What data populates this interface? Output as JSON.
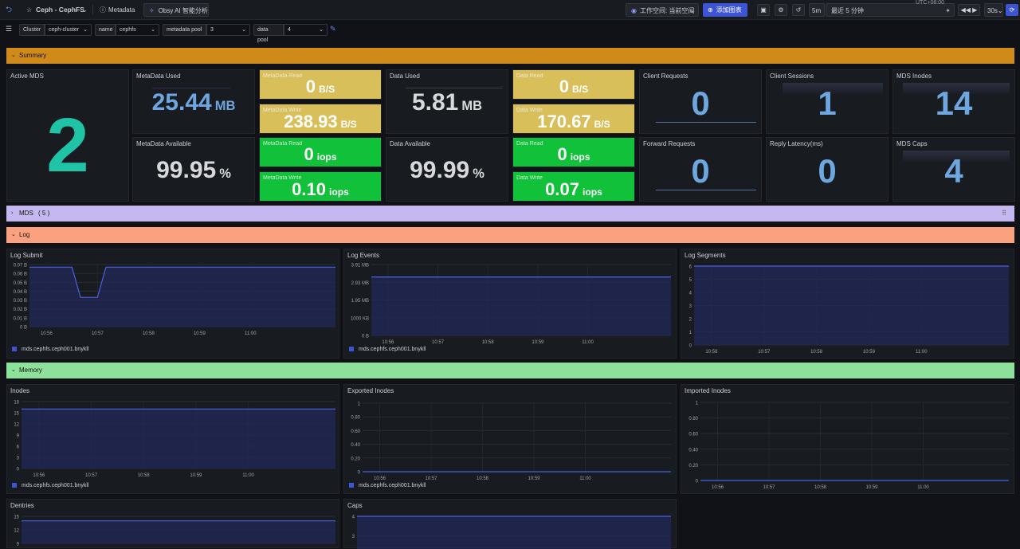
{
  "topbar": {
    "title": "Ceph - CephFS",
    "metadata_label": "Metadata",
    "ai_label": "Obsy AI 智能分析",
    "workspace_label": "工作空间: 当前空间",
    "add_chart_label": "添加图表",
    "time_short": "5m",
    "time_range": "最近 5 分钟",
    "refresh_interval": "30s",
    "timezone": "UTC+08:00"
  },
  "filters": [
    {
      "label": "Cluster",
      "value": "ceph-cluster"
    },
    {
      "label": "name",
      "value": "cephfs"
    },
    {
      "label": "metadata pool",
      "value": "3"
    },
    {
      "label": "data pool",
      "value": "4"
    }
  ],
  "rows": {
    "summary": "Summary",
    "mds": "MDS",
    "mds_count": "( 5 )",
    "log": "Log",
    "memory": "Memory"
  },
  "colors": {
    "summary": "#d08a1a",
    "mds": "#c5b8f0",
    "log": "#fba17f",
    "memory": "#8ee19b",
    "yellow_tile": "#d9bf59",
    "green_tile": "#11c13a",
    "series": "#3d55d4"
  },
  "summary": {
    "active_mds": {
      "title": "Active MDS",
      "value": "2"
    },
    "metadata_used": {
      "title": "MetaData Used",
      "value": "25.44",
      "unit": "MB"
    },
    "metadata_available": {
      "title": "MetaData Available",
      "value": "99.95",
      "unit": "%"
    },
    "data_used": {
      "title": "Data Used",
      "value": "5.81",
      "unit": "MB"
    },
    "data_available": {
      "title": "Data Available",
      "value": "99.99",
      "unit": "%"
    },
    "md_read_bs": {
      "title": "MetaData Read",
      "value": "0",
      "unit": "B/S"
    },
    "md_write_bs": {
      "title": "MetaData Write",
      "value": "238.93",
      "unit": "B/S"
    },
    "md_read_iops": {
      "title": "MetaData Read",
      "value": "0",
      "unit": "iops"
    },
    "md_write_iops": {
      "title": "MetaData Write",
      "value": "0.10",
      "unit": "iops"
    },
    "data_read_bs": {
      "title": "Data Read",
      "value": "0",
      "unit": "B/S"
    },
    "data_write_bs": {
      "title": "Data Write",
      "value": "170.67",
      "unit": "B/S"
    },
    "data_read_iops": {
      "title": "Data Read",
      "value": "0",
      "unit": "iops"
    },
    "data_write_iops": {
      "title": "Data Write",
      "value": "0.07",
      "unit": "iops"
    },
    "client_requests": {
      "title": "Client Requests",
      "value": "0"
    },
    "client_sessions": {
      "title": "Client Sessions",
      "value": "1"
    },
    "mds_inodes": {
      "title": "MDS Inodes",
      "value": "14"
    },
    "forward_requests": {
      "title": "Forward Requests",
      "value": "0"
    },
    "reply_latency": {
      "title": "Reply Latency(ms)",
      "value": "0"
    },
    "mds_caps": {
      "title": "MDS Caps",
      "value": "4"
    }
  },
  "chart_data": [
    {
      "id": "log-submit",
      "type": "line",
      "title": "Log Submit",
      "x": [
        "10:56",
        "10:57",
        "10:58",
        "10:59",
        "11:00"
      ],
      "y_ticks": [
        "0 B",
        "0.01 B",
        "0.02 B",
        "0.03 B",
        "0.04 B",
        "0.05 B",
        "0.06 B",
        "0.07 B"
      ],
      "ylim": [
        0,
        0.07
      ],
      "series": [
        {
          "name": "mds.cephfs.ceph001.bnykll",
          "points": [
            [
              "10:55:40",
              0.067
            ],
            [
              "10:56:30",
              0.067
            ],
            [
              "10:56:40",
              0.033
            ],
            [
              "10:57:00",
              0.033
            ],
            [
              "10:57:10",
              0.067
            ],
            [
              "11:01:40",
              0.067
            ]
          ]
        }
      ],
      "legend": true
    },
    {
      "id": "log-events",
      "type": "area",
      "title": "Log Events",
      "x": [
        "10:56",
        "10:57",
        "10:58",
        "10:59",
        "11:00"
      ],
      "y_ticks": [
        "0 B",
        "1000 KB",
        "1.95 MB",
        "2.93 MB",
        "3.91 MB"
      ],
      "ylim": [
        0,
        4
      ],
      "series": [
        {
          "name": "mds.cephfs.ceph001.bnykll",
          "points": [
            [
              "10:55:40",
              3.3
            ],
            [
              "11:01:40",
              3.3
            ]
          ]
        }
      ],
      "legend": true
    },
    {
      "id": "log-segments",
      "type": "area",
      "title": "Log Segments",
      "x": [
        "10:56",
        "10:57",
        "10:58",
        "10:59",
        "11:00"
      ],
      "y_ticks": [
        "0",
        "1",
        "2",
        "3",
        "4",
        "5",
        "6"
      ],
      "ylim": [
        0,
        6
      ],
      "series": [
        {
          "points": [
            [
              "10:55:40",
              6
            ],
            [
              "11:01:40",
              6
            ]
          ]
        }
      ],
      "legend": false
    },
    {
      "id": "inodes",
      "type": "area",
      "title": "Inodes",
      "x": [
        "10:56",
        "10:57",
        "10:58",
        "10:59",
        "11:00"
      ],
      "y_ticks": [
        "0",
        "3",
        "6",
        "9",
        "12",
        "15",
        "18"
      ],
      "ylim": [
        0,
        18
      ],
      "series": [
        {
          "name": "mds.cephfs.ceph001.bnykll",
          "points": [
            [
              "10:55:40",
              16
            ],
            [
              "11:01:40",
              16
            ]
          ]
        }
      ],
      "legend": true
    },
    {
      "id": "exported-inodes",
      "type": "line",
      "title": "Exported Inodes",
      "x": [
        "10:56",
        "10:57",
        "10:58",
        "10:59",
        "11:00"
      ],
      "y_ticks": [
        "0",
        "0.20",
        "0.40",
        "0.60",
        "0.80",
        "1"
      ],
      "ylim": [
        0,
        1
      ],
      "series": [
        {
          "name": "mds.cephfs.ceph001.bnykll",
          "points": [
            [
              "10:55:40",
              0
            ],
            [
              "11:01:40",
              0
            ]
          ]
        }
      ],
      "legend": true
    },
    {
      "id": "imported-inodes",
      "type": "line",
      "title": "Imported Inodes",
      "x": [
        "10:56",
        "10:57",
        "10:58",
        "10:59",
        "11:00"
      ],
      "y_ticks": [
        "0",
        "0.20",
        "0.40",
        "0.60",
        "0.80",
        "1"
      ],
      "ylim": [
        0,
        1
      ],
      "series": [
        {
          "points": [
            [
              "10:55:40",
              0
            ],
            [
              "11:01:40",
              0
            ]
          ]
        }
      ],
      "legend": false
    },
    {
      "id": "dentries",
      "type": "area",
      "title": "Dentries",
      "x": [],
      "y_ticks": [
        "9",
        "12",
        "15"
      ],
      "ylim": [
        0,
        15
      ],
      "series": [
        {
          "points": [
            [
              "10:55:40",
              14
            ],
            [
              "11:01:40",
              14
            ]
          ]
        }
      ],
      "legend": false
    },
    {
      "id": "caps",
      "type": "area",
      "title": "Caps",
      "x": [],
      "y_ticks": [
        "3",
        "4"
      ],
      "ylim": [
        0,
        4
      ],
      "series": [
        {
          "points": [
            [
              "10:55:40",
              4
            ],
            [
              "11:01:40",
              4
            ]
          ]
        }
      ],
      "legend": false
    }
  ]
}
